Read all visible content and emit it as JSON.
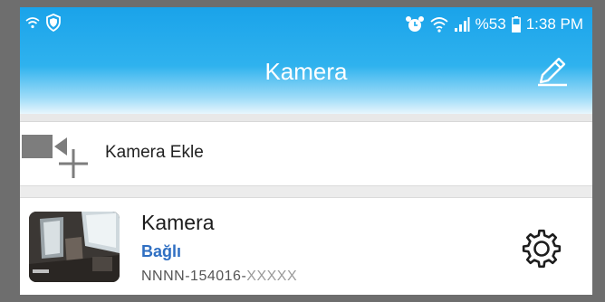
{
  "status_bar": {
    "left_icons": [
      "wifi-icon",
      "shield-icon"
    ],
    "right_icons": [
      "alarm-icon",
      "wifi-icon",
      "signal-icon",
      "battery-icon"
    ],
    "battery": "%53",
    "time": "1:38 PM"
  },
  "header": {
    "title": "Kamera",
    "edit_icon": "pencil-icon"
  },
  "add_camera": {
    "label": "Kamera Ekle",
    "icon": "add-camera-icon"
  },
  "cameras": [
    {
      "name": "Kamera",
      "status": "Bağlı",
      "id_prefix": "NNNN-154016-",
      "id_masked": "XXXXX",
      "settings_icon": "gear-icon"
    }
  ],
  "colors": {
    "header_top": "#1aa3ea",
    "status_connected": "#2f6fc2",
    "frame_border": "#6e6e6e"
  }
}
